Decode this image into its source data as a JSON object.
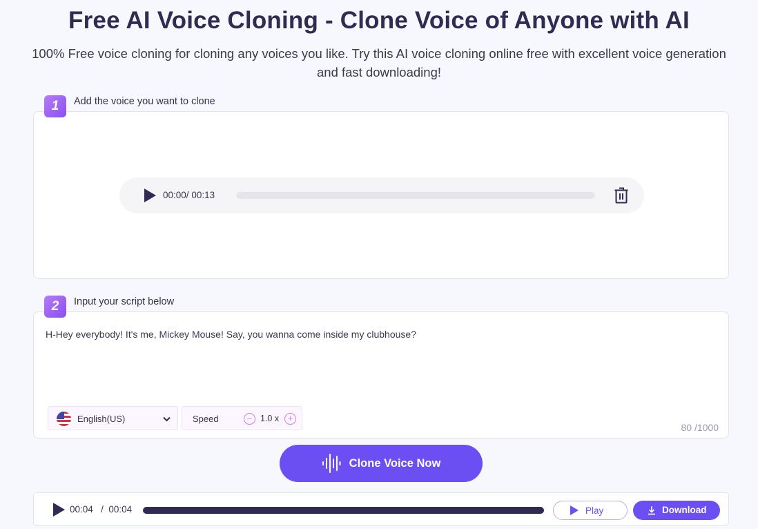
{
  "header": {
    "title": "Free AI Voice Cloning - Clone Voice of Anyone with AI",
    "subtitle_line1": "100% Free voice cloning for cloning any voices you like. Try this AI voice cloning online free with excellent voice generation",
    "subtitle_line2": "and fast downloading!"
  },
  "step1": {
    "number": "1",
    "label": "Add the voice you want to clone",
    "player": {
      "current_time": "00:00",
      "separator": "/",
      "duration": "00:13",
      "progress": 0,
      "play_icon": "play-icon",
      "delete_icon": "trash-icon"
    }
  },
  "step2": {
    "number": "2",
    "label": "Input your script below",
    "script": "H-Hey everybody! It's me, Mickey Mouse! Say, you wanna come inside my clubhouse?",
    "language": {
      "flag_icon": "us-flag-icon",
      "selected": "English(US)"
    },
    "speed": {
      "label": "Speed",
      "value": "1.0 x",
      "decrease": "−",
      "increase": "+"
    },
    "counter": "80 /1000"
  },
  "clone_button": {
    "label": "Clone Voice Now",
    "icon": "sound-wave-icon"
  },
  "result_player": {
    "current_time": "00:04",
    "separator": "/",
    "duration": "00:04",
    "progress": 1.0,
    "play_label": "Play",
    "download_label": "Download"
  },
  "colors": {
    "accent": "#6b4ff3",
    "badge_start": "#b57cf5",
    "badge_end": "#8a4ef0",
    "title": "#2f2b52",
    "background": "#f6f8fd"
  }
}
